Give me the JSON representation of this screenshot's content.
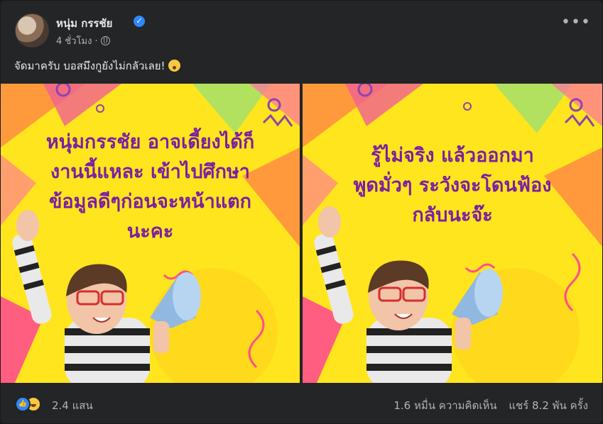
{
  "post": {
    "author": "หนุ่ม กรรชัย",
    "verified_mark": "✓",
    "time": "4 ชั่วโมง ·",
    "more_label": "•••",
    "caption": "จัดมาครับ บอสมึงกูยังไม่กลัวเลย!",
    "images": [
      {
        "lines": [
          "หนุ่มกรรชัย อาจเดี้ยงได้ก็",
          "งานนี้แหละ เข้าไปศึกษา",
          "ข้อมูลดีๆก่อนจะหน้าแตก",
          "นะคะ"
        ]
      },
      {
        "lines": [
          "รู้ไม่จริง แล้วออกมา",
          "พูดมั่วๆ ระวังจะโดนฟ้อง",
          "กลับนะจ๊ะ"
        ]
      }
    ],
    "reaction_count": "2.4 แสน",
    "comments": "1.6 หมื่น ความคิดเห็น",
    "shares": "แชร์ 8.2 พัน ครั้ง"
  },
  "colors": {
    "background": "#242526",
    "poster_yellow": "#ffe51e",
    "poster_text": "#7b1fa2",
    "accent": "#2d88ff"
  },
  "icons": [
    "verified-icon",
    "globe-icon",
    "more-icon",
    "like-reaction-icon",
    "haha-reaction-icon",
    "astonished-emoji-icon"
  ]
}
